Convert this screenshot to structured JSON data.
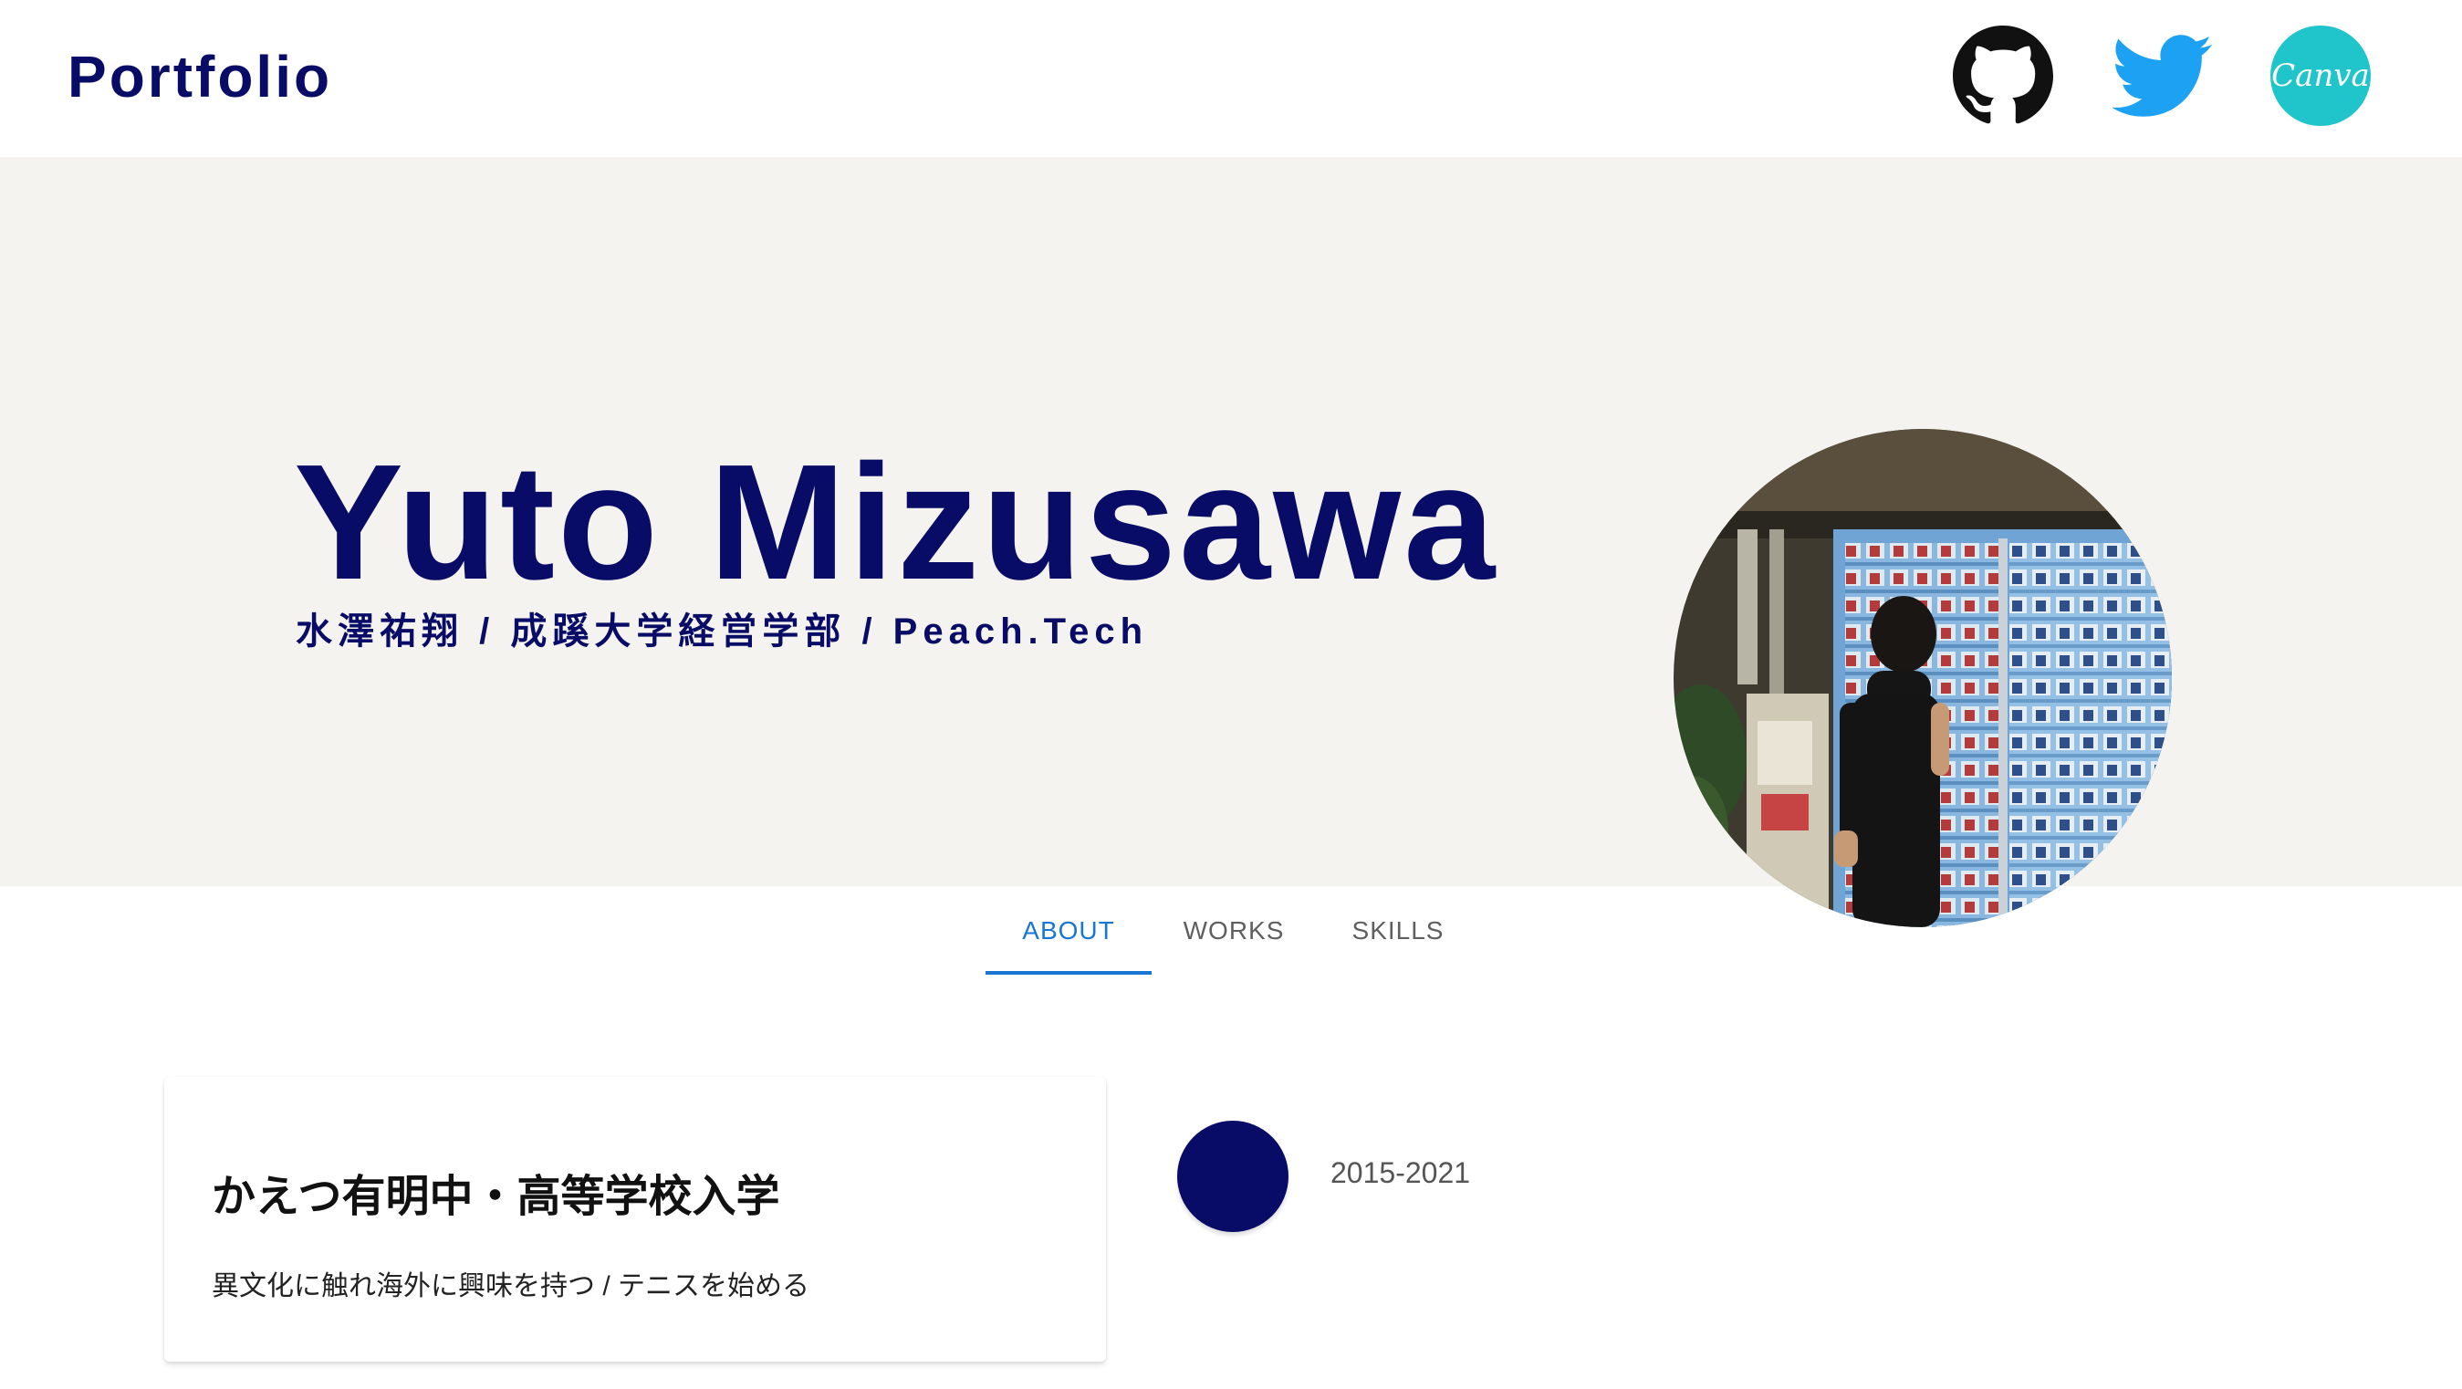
{
  "header": {
    "brand": "Portfolio",
    "links": [
      {
        "name": "GitHub",
        "icon": "github-icon"
      },
      {
        "name": "Twitter",
        "icon": "twitter-icon"
      },
      {
        "name": "Canva",
        "icon": "canva-icon",
        "label": "Canva"
      }
    ]
  },
  "hero": {
    "name": "Yuto Mizusawa",
    "subtitle": "水澤祐翔 / 成蹊大学経営学部 / Peach.Tech",
    "photo": "profile-photo"
  },
  "tabs": [
    {
      "label": "ABOUT",
      "active": true
    },
    {
      "label": "WORKS",
      "active": false
    },
    {
      "label": "SKILLS",
      "active": false
    }
  ],
  "timeline": {
    "items": [
      {
        "title": "かえつ有明中・高等学校入学",
        "description": "異文化に触れ海外に興味を持つ / テニスを始める",
        "period": "2015-2021"
      }
    ]
  },
  "colors": {
    "primary": "#080c66",
    "accent": "#1976d2",
    "hero_bg": "#f4f3ef",
    "twitter": "#1da1f2",
    "canva": "#20c4cb"
  }
}
